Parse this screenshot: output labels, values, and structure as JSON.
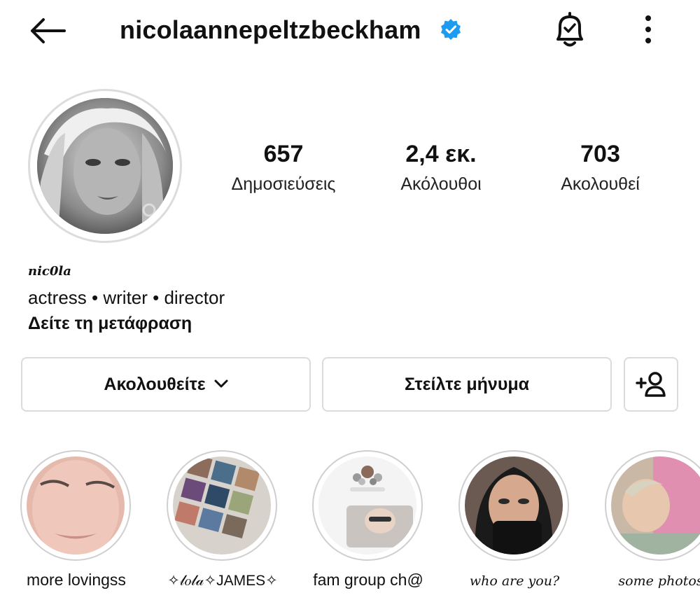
{
  "header": {
    "username": "nicolaannepeltzbeckham",
    "icons": [
      "back-arrow-icon",
      "verified-badge-icon",
      "notification-bell-icon",
      "more-options-icon"
    ]
  },
  "stats": {
    "posts_value": "657",
    "posts_label": "Δημοσιεύσεις",
    "followers_value": "2,4 εκ.",
    "followers_label": "Ακόλουθοι",
    "following_value": "703",
    "following_label": "Ακολουθεί"
  },
  "bio": {
    "name": "nic0la",
    "line": "actress • writer • director",
    "translate": "Δείτε τη μετάφραση"
  },
  "actions": {
    "following_label": "Ακολουθείτε",
    "message_label": "Στείλτε μήνυμα"
  },
  "highlights": [
    {
      "label": "more lovingss"
    },
    {
      "label": "✧𝓁𝑜𝓁𝒶✧JAMES✧"
    },
    {
      "label": "fam group ch@"
    },
    {
      "label": "who are you?"
    },
    {
      "label": "some photos"
    }
  ],
  "colors": {
    "verified": "#1d9bf0",
    "border": "#dbdbdb",
    "text": "#111111"
  }
}
